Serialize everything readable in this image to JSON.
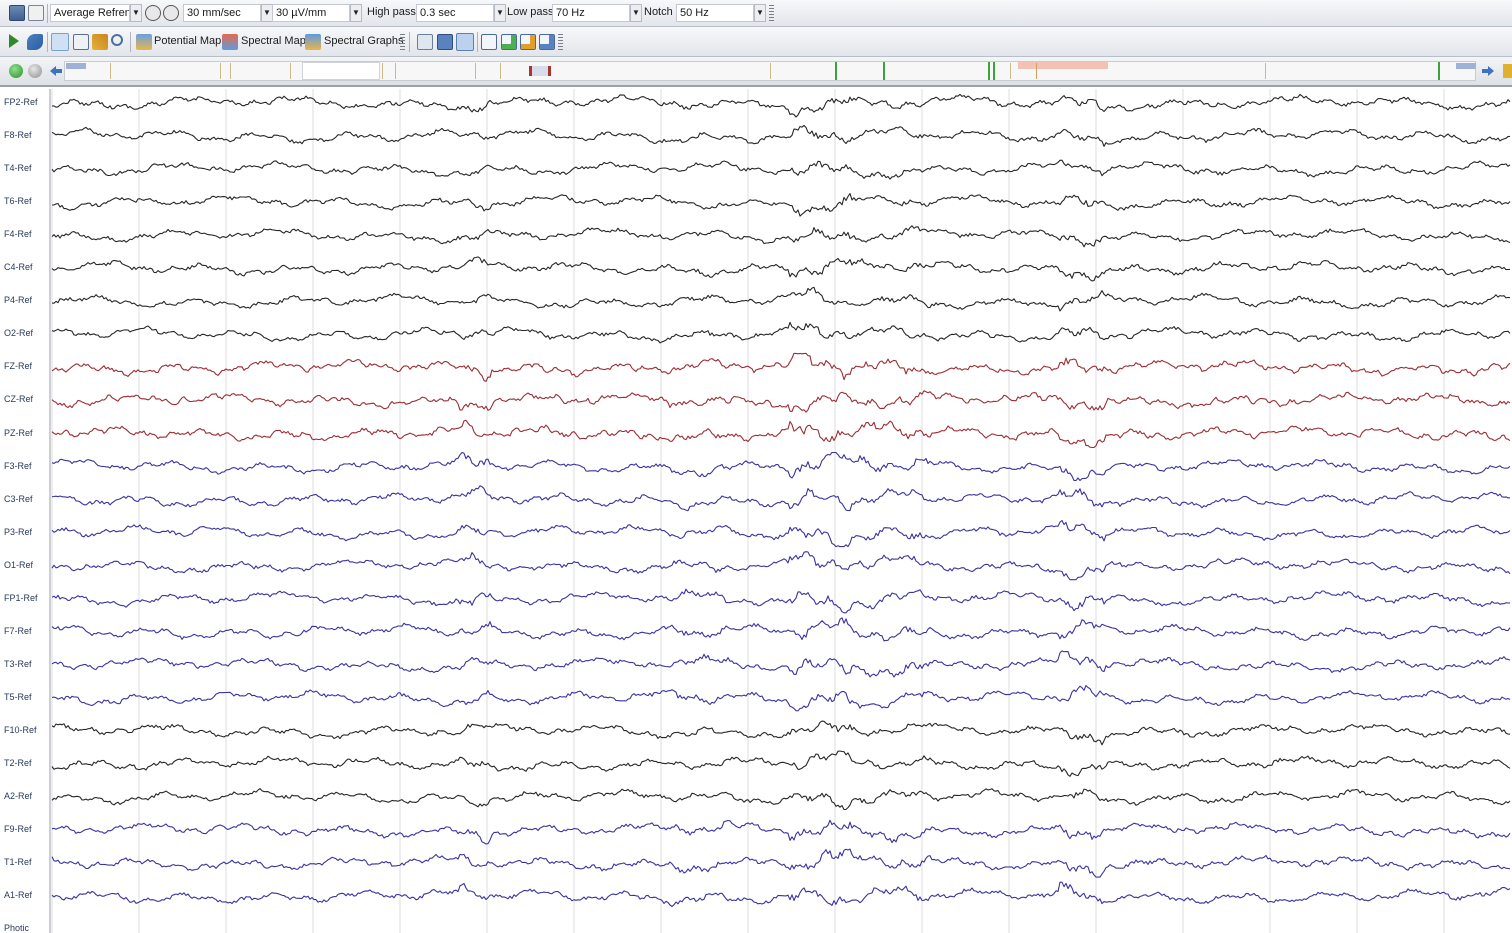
{
  "toolbar": {
    "montage": "Average Refrenc",
    "speed": "30 mm/sec",
    "sensitivity": "30 µV/mm",
    "high_pass_label": "High pass",
    "high_pass_value": "0.3 sec",
    "low_pass_label": "Low pass",
    "low_pass_value": "70 Hz",
    "notch_label": "Notch",
    "notch_value": "50 Hz"
  },
  "tools": {
    "potential_map": "Potential Map",
    "spectral_map": "Spectral Map",
    "spectral_graphs": "Spectral Graphs"
  },
  "channels": [
    {
      "name": "FP2-Ref",
      "color": "#262626"
    },
    {
      "name": "F8-Ref",
      "color": "#262626"
    },
    {
      "name": "T4-Ref",
      "color": "#262626"
    },
    {
      "name": "T6-Ref",
      "color": "#262626"
    },
    {
      "name": "F4-Ref",
      "color": "#262626"
    },
    {
      "name": "C4-Ref",
      "color": "#262626"
    },
    {
      "name": "P4-Ref",
      "color": "#262626"
    },
    {
      "name": "O2-Ref",
      "color": "#262626"
    },
    {
      "name": "FZ-Ref",
      "color": "#9b2d34"
    },
    {
      "name": "CZ-Ref",
      "color": "#9b2d34"
    },
    {
      "name": "PZ-Ref",
      "color": "#9b2d34"
    },
    {
      "name": "F3-Ref",
      "color": "#3a32a0"
    },
    {
      "name": "C3-Ref",
      "color": "#3a32a0"
    },
    {
      "name": "P3-Ref",
      "color": "#3a32a0"
    },
    {
      "name": "O1-Ref",
      "color": "#3a32a0"
    },
    {
      "name": "FP1-Ref",
      "color": "#3a32a0"
    },
    {
      "name": "F7-Ref",
      "color": "#3a32a0"
    },
    {
      "name": "T3-Ref",
      "color": "#3a32a0"
    },
    {
      "name": "T5-Ref",
      "color": "#3a32a0"
    },
    {
      "name": "F10-Ref",
      "color": "#262626"
    },
    {
      "name": "T2-Ref",
      "color": "#262626"
    },
    {
      "name": "A2-Ref",
      "color": "#262626"
    },
    {
      "name": "F9-Ref",
      "color": "#3a32a0"
    },
    {
      "name": "T1-Ref",
      "color": "#3a32a0"
    },
    {
      "name": "A1-Ref",
      "color": "#3a32a0"
    },
    {
      "name": "Photic",
      "color": "#262626"
    }
  ],
  "colors": {
    "trace_black": "#262626",
    "trace_red": "#9b2d34",
    "trace_blue": "#3a32a0",
    "gridline": "#dcdcdc",
    "marker_green": "#3da33d",
    "selection_pink": "#f2c3b4"
  },
  "icons": {
    "toolbar1": [
      "print-icon",
      "print-preview-icon",
      "zoom-out-icon",
      "zoom-in-icon"
    ],
    "toolbar2": [
      "play-icon",
      "rewind-icon",
      "select-pointer-icon",
      "measure-icon",
      "annotate-pen-icon",
      "magnifier-icon",
      "potential-map-icon",
      "spectral-map-icon",
      "spectral-graphs-icon",
      "montage-icon",
      "view-single-icon",
      "view-split-icon",
      "window-icon",
      "window-add-icon",
      "window-copy-icon",
      "window-remove-icon"
    ],
    "navbar": [
      "go-green-icon",
      "stop-icon",
      "scroll-left-icon",
      "scroll-right-icon"
    ]
  }
}
